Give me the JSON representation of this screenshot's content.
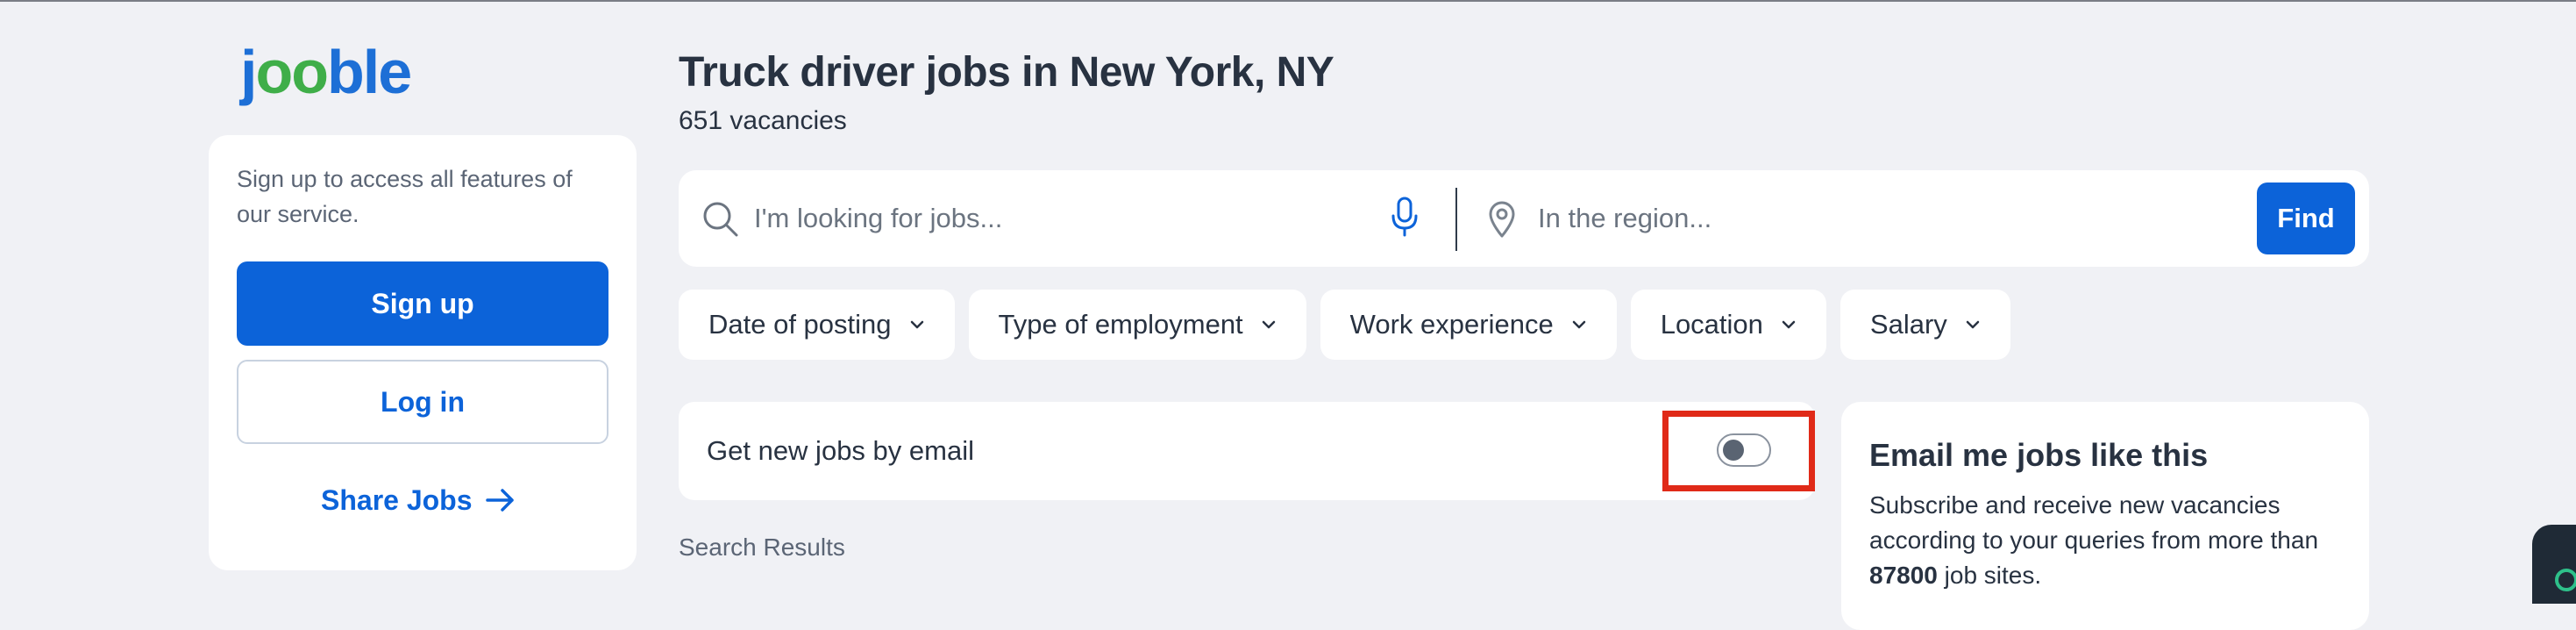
{
  "logo": {
    "part1": "j",
    "part2": "oo",
    "part3": "ble"
  },
  "sidebar": {
    "prompt": "Sign up to access all features of our service.",
    "signup_label": "Sign up",
    "login_label": "Log in",
    "share_label": "Share Jobs"
  },
  "header": {
    "title": "Truck driver jobs in New York, NY",
    "vacancies": "651 vacancies"
  },
  "search": {
    "query_placeholder": "I'm looking for jobs...",
    "region_placeholder": "In the region...",
    "find_label": "Find"
  },
  "filters": [
    {
      "label": "Date of posting"
    },
    {
      "label": "Type of employment"
    },
    {
      "label": "Work experience"
    },
    {
      "label": "Location"
    },
    {
      "label": "Salary"
    }
  ],
  "email_alert": {
    "label": "Get new jobs by email",
    "toggle_on": false
  },
  "results": {
    "label": "Search Results"
  },
  "subscribe_card": {
    "title": "Email me jobs like this",
    "text_before": "Subscribe and receive new vacancies according to your queries from more than",
    "sites_count": "87800",
    "text_after": "job sites."
  },
  "colors": {
    "primary": "#0c63d9",
    "background": "#f0f1f5",
    "text": "#283241",
    "highlight": "#e02a18",
    "logo_green": "#3fae49"
  },
  "icons": {
    "search": "search-icon",
    "mic": "microphone-icon",
    "location": "location-pin-icon",
    "arrow": "arrow-right-icon",
    "chevron": "chevron-down-icon"
  }
}
